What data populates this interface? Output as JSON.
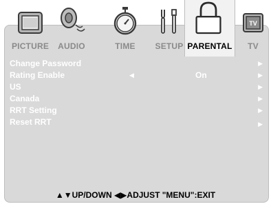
{
  "tabs": [
    {
      "label": "PICTURE",
      "icon": "picture-icon",
      "active": false
    },
    {
      "label": "AUDIO",
      "icon": "speaker-icon",
      "active": false
    },
    {
      "label": "TIME",
      "icon": "stopwatch-icon",
      "active": false
    },
    {
      "label": "SETUP",
      "icon": "tools-icon",
      "active": false
    },
    {
      "label": "PARENTAL",
      "icon": "padlock-icon",
      "active": true
    },
    {
      "label": "TV",
      "icon": "tv-icon",
      "active": false
    }
  ],
  "menu": {
    "items": [
      {
        "label": "Change Password",
        "left_arrow": "",
        "value": "",
        "right_arrow": "▶"
      },
      {
        "label": "Rating Enable",
        "left_arrow": "◀",
        "value": "On",
        "right_arrow": "▶"
      },
      {
        "label": "US",
        "left_arrow": "",
        "value": "",
        "right_arrow": "▶"
      },
      {
        "label": "Canada",
        "left_arrow": "",
        "value": "",
        "right_arrow": "▶"
      },
      {
        "label": "RRT Setting",
        "left_arrow": "",
        "value": "",
        "right_arrow": "▶"
      },
      {
        "label": "Reset RRT",
        "left_arrow": "",
        "value": "",
        "right_arrow": "▶"
      }
    ]
  },
  "footer": {
    "hint": "▲▼UP/DOWN  ◀▶ADJUST  \"MENU\":EXIT"
  },
  "colors": {
    "panel": "#d9d9d9",
    "active_tab": "#f2f2f2",
    "inactive_label": "#8a8a8a",
    "row_text": "#ffffff"
  }
}
